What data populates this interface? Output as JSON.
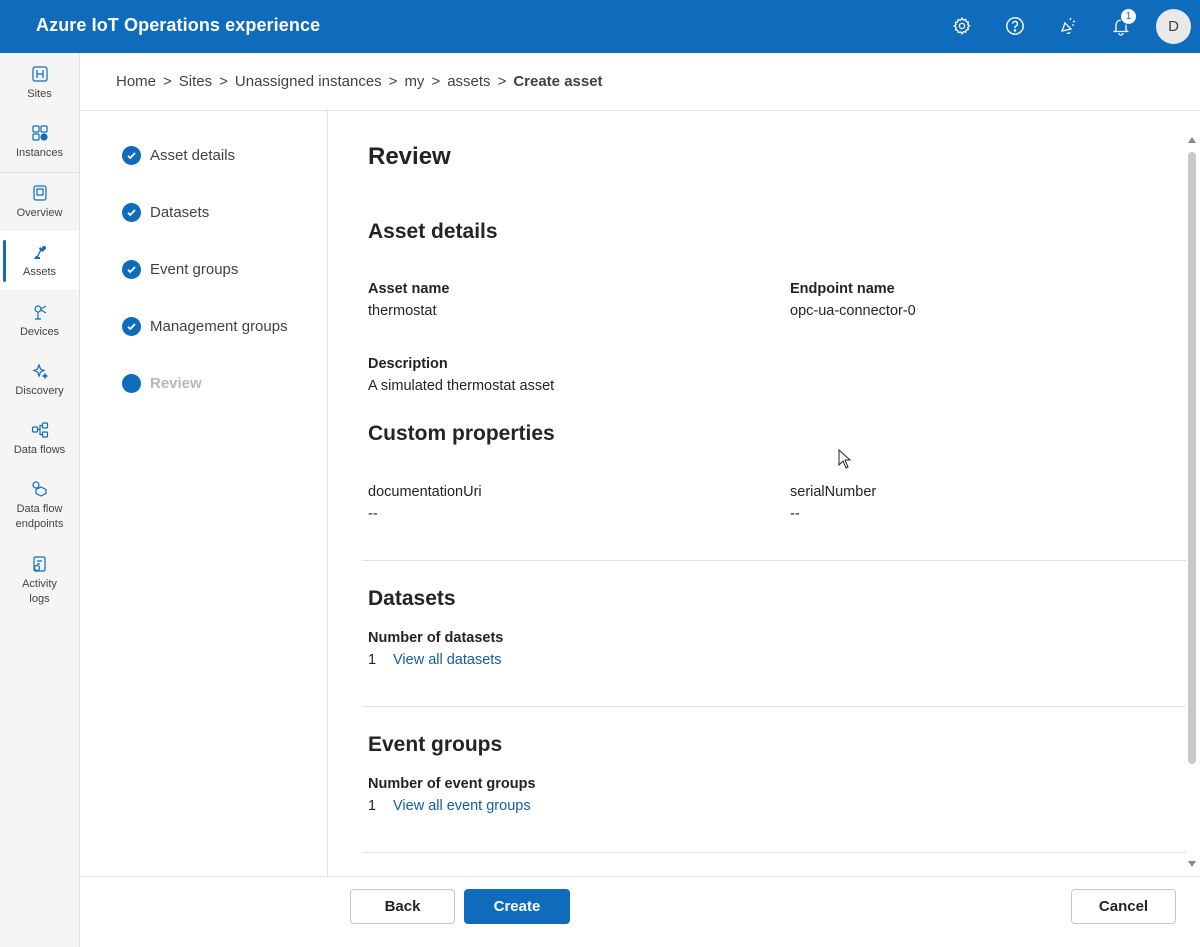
{
  "header": {
    "title": "Azure IoT Operations experience",
    "notification_count": "1",
    "avatar_initial": "D",
    "icons": [
      "gear-icon",
      "help-icon",
      "feedback-icon",
      "bell-icon"
    ]
  },
  "rail": {
    "items": [
      {
        "label": "Sites",
        "icon": "sites-icon"
      },
      {
        "label": "Instances",
        "icon": "instances-icon"
      },
      {
        "label": "Overview",
        "icon": "overview-icon"
      },
      {
        "label": "Assets",
        "icon": "assets-icon",
        "active": true
      },
      {
        "label": "Devices",
        "icon": "devices-icon"
      },
      {
        "label": "Discovery",
        "icon": "discovery-icon"
      },
      {
        "label": "Data flows",
        "icon": "data-flows-icon"
      },
      {
        "label": "Data flow endpoints",
        "icon": "data-flow-endpoints-icon"
      },
      {
        "label": "Activity logs",
        "icon": "activity-logs-icon"
      }
    ]
  },
  "breadcrumb": {
    "items": [
      "Home",
      "Sites",
      "Unassigned instances",
      "my",
      "assets"
    ],
    "current": "Create asset",
    "separator": ">"
  },
  "steps": [
    {
      "label": "Asset details",
      "state": "completed"
    },
    {
      "label": "Datasets",
      "state": "completed"
    },
    {
      "label": "Event groups",
      "state": "completed"
    },
    {
      "label": "Management groups",
      "state": "completed"
    },
    {
      "label": "Review",
      "state": "current"
    }
  ],
  "review": {
    "title": "Review",
    "asset_details": {
      "heading": "Asset details",
      "asset_name_label": "Asset name",
      "asset_name": "thermostat",
      "endpoint_name_label": "Endpoint name",
      "endpoint_name": "opc-ua-connector-0",
      "description_label": "Description",
      "description": "A simulated thermostat asset"
    },
    "custom_properties": {
      "heading": "Custom properties",
      "prop1_label": "documentationUri",
      "prop1_value": "--",
      "prop2_label": "serialNumber",
      "prop2_value": "--"
    },
    "datasets": {
      "heading": "Datasets",
      "count_label": "Number of datasets",
      "count": "1",
      "link": "View all datasets"
    },
    "event_groups": {
      "heading": "Event groups",
      "count_label": "Number of event groups",
      "count": "1",
      "link": "View all event groups"
    }
  },
  "footer": {
    "back": "Back",
    "create": "Create",
    "cancel": "Cancel"
  },
  "colors": {
    "brand": "#0f6cbd",
    "link": "#115ea3",
    "rail_bg": "#f5f5f5"
  }
}
